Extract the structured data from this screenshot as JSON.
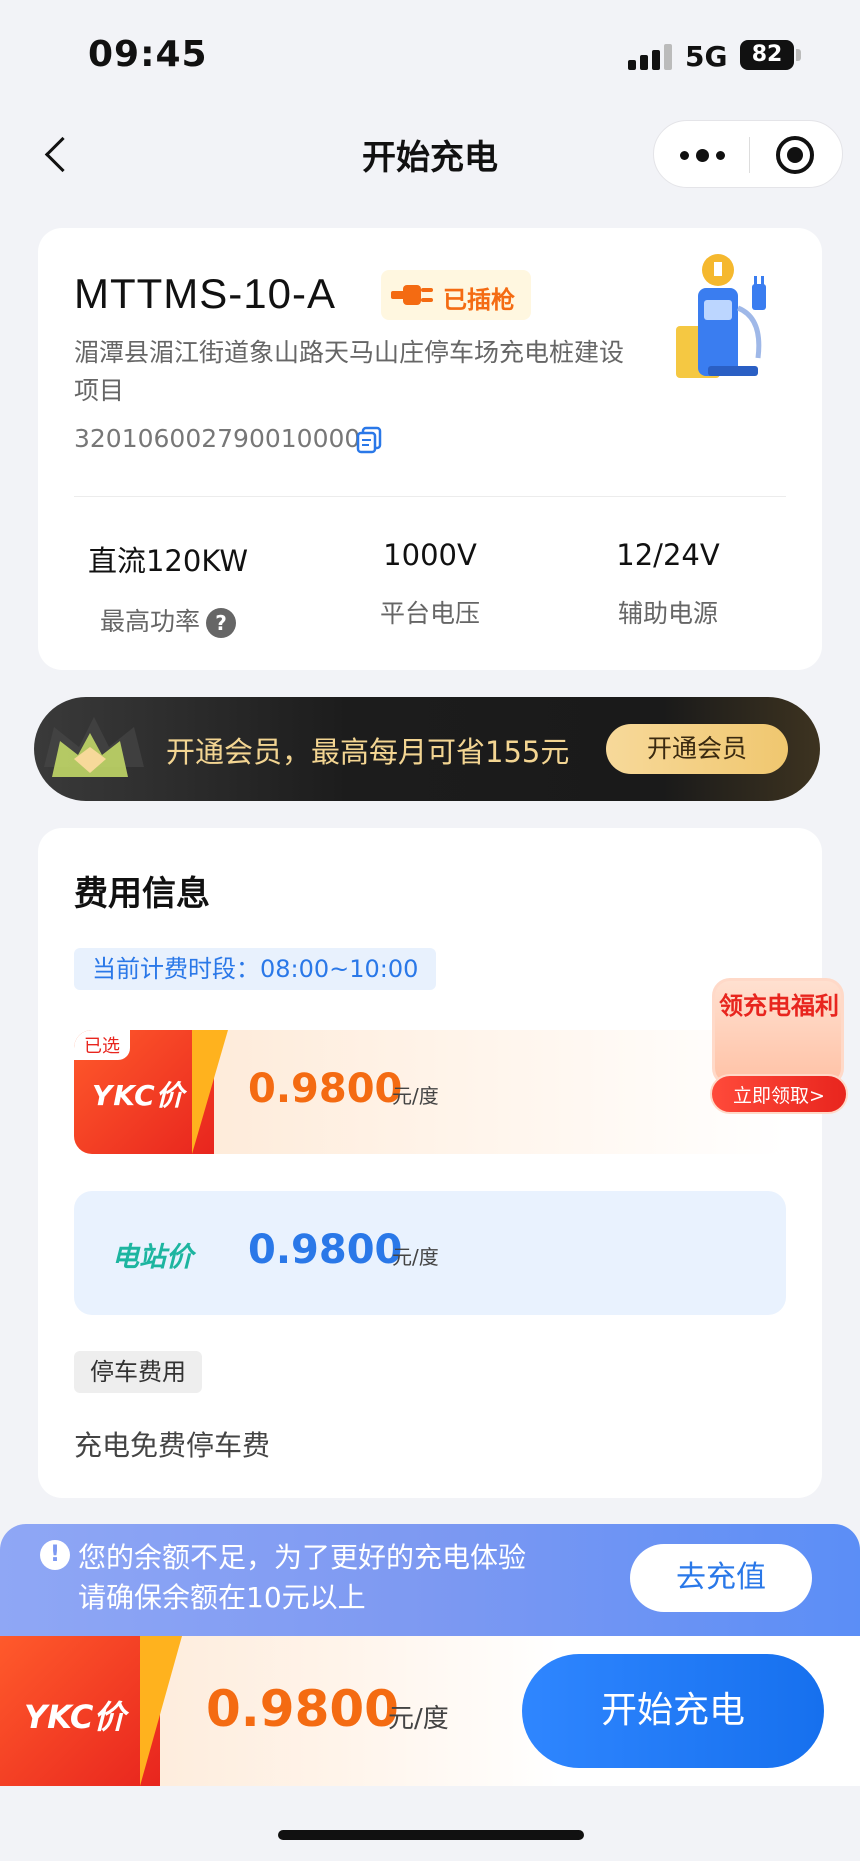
{
  "status_bar": {
    "time": "09:45",
    "network": "5G",
    "battery": "82"
  },
  "nav": {
    "title": "开始充电"
  },
  "station": {
    "code": "MTTMS-10-A",
    "plug_status": "已插枪",
    "address": "湄潭县湄江街道象山路天马山庄停车场充电桩建设项目",
    "id": "320106002790010000",
    "specs": [
      {
        "value": "直流120KW",
        "label": "最高功率"
      },
      {
        "value": "1000V",
        "label": "平台电压"
      },
      {
        "value": "12/24V",
        "label": "辅助电源"
      }
    ]
  },
  "member_banner": {
    "text": "开通会员，最高每月可省155元",
    "button": "开通会员"
  },
  "fee": {
    "title": "费用信息",
    "period": "当前计费时段：08:00~10:00",
    "ykc": {
      "selected": "已选",
      "label": "YKC价",
      "price": "0.9800",
      "unit": "元/度"
    },
    "station_price": {
      "label": "电站价",
      "price": "0.9800",
      "unit": "元/度"
    },
    "parking_tag": "停车费用",
    "parking_text": "充电免费停车费"
  },
  "promo": {
    "title": "领充电福利",
    "button": "立即领取>"
  },
  "alert": {
    "text": "您的余额不足，为了更好的充电体验请确保余额在10元以上",
    "button": "去充值"
  },
  "bottom": {
    "label": "YKC价",
    "price": "0.9800",
    "unit": "元/度",
    "start_button": "开始充电"
  },
  "colors": {
    "primary": "#1670ee",
    "accent": "#f46b12",
    "ykc_red": "#e8251e",
    "member_gold": "#f0c76f"
  }
}
